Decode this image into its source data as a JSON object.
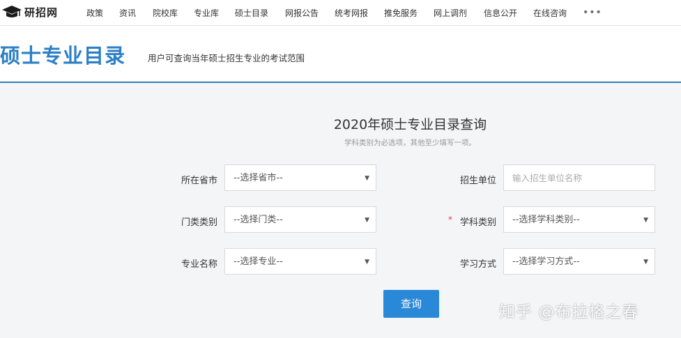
{
  "topbar": {
    "logo_text": "研招网",
    "nav": [
      "政策",
      "资讯",
      "院校库",
      "专业库",
      "硕士目录",
      "网报公告",
      "统考网报",
      "推免服务",
      "网上调剂",
      "信息公开",
      "在线咨询"
    ],
    "more": "•••"
  },
  "header": {
    "title": "硕士专业目录",
    "subtitle": "用户可查询当年硕士招生专业的考试范围"
  },
  "form": {
    "title": "2020年硕士专业目录查询",
    "note": "学科类别为必选项，其他至少填写一项。",
    "province": {
      "label": "所在省市",
      "value": "--选择省市--"
    },
    "school": {
      "label": "招生单位",
      "placeholder": "输入招生单位名称"
    },
    "category": {
      "label": "门类类别",
      "value": "--选择门类--"
    },
    "subject": {
      "label": "学科类别",
      "value": "--选择学科类别--",
      "required_mark": "*"
    },
    "major": {
      "label": "专业名称",
      "value": "--选择专业--"
    },
    "mode": {
      "label": "学习方式",
      "value": "--选择学习方式--"
    },
    "submit_label": "查询"
  },
  "watermark": "知乎 @布拉格之春",
  "colors": {
    "accent": "#2b7fc7",
    "button": "#2a88d8",
    "required": "#e4393c"
  }
}
